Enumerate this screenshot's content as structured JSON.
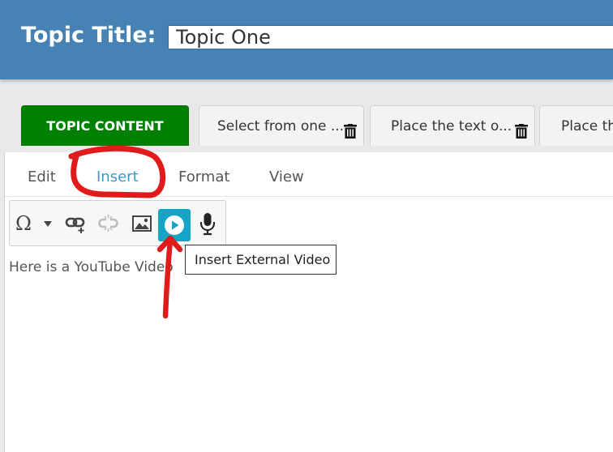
{
  "header": {
    "title_label": "Topic Title:",
    "title_value": "Topic One"
  },
  "tabs": [
    {
      "label": "TOPIC CONTENT"
    },
    {
      "label": "Select from one ..."
    },
    {
      "label": "Place the text o..."
    },
    {
      "label": "Place th"
    }
  ],
  "menubar": {
    "items": [
      "Edit",
      "Insert",
      "Format",
      "View"
    ],
    "active": "Insert"
  },
  "toolbar": {
    "icons": [
      "omega-icon",
      "dropdown-arrow-icon",
      "insert-link-icon",
      "unlink-icon",
      "image-icon",
      "play-video-icon",
      "microphone-icon"
    ],
    "highlight_color": "#13a4c6"
  },
  "editor": {
    "content": "Here is a YouTube Video"
  },
  "tooltip": {
    "text": "Insert External Video"
  },
  "colors": {
    "header_bg": "#4682b4",
    "active_tab_bg": "#008000",
    "annotation_red": "#e11b1b"
  }
}
